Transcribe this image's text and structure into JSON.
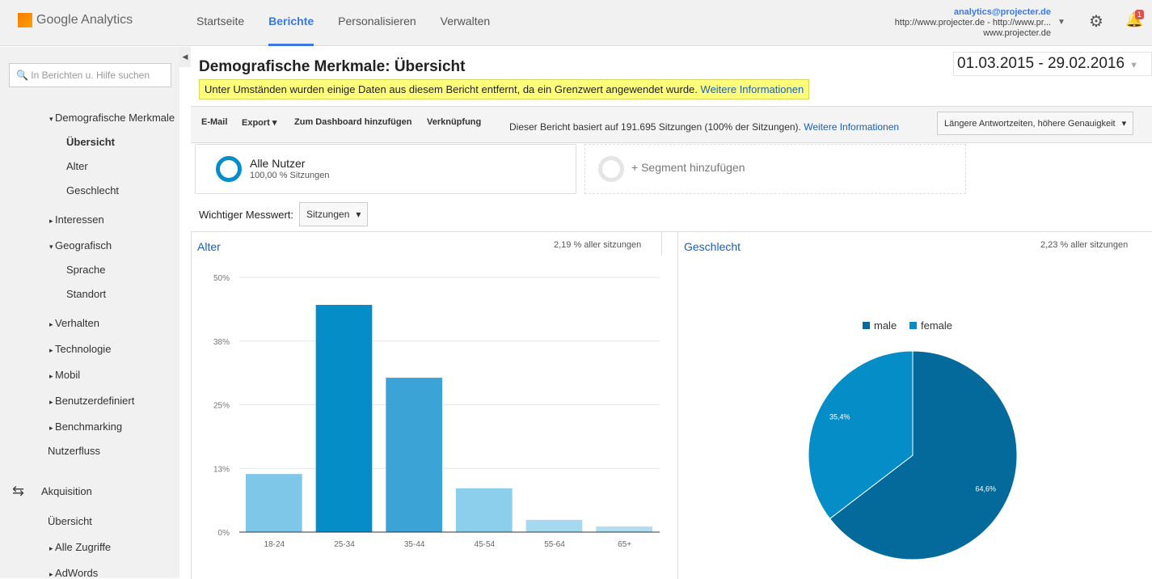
{
  "header": {
    "logo": "Google Analytics",
    "nav": [
      "Startseite",
      "Berichte",
      "Personalisieren",
      "Verwalten"
    ],
    "active_nav": "Berichte",
    "account_email": "analytics@projecter.de",
    "account_property": "http://www.projecter.de - http://www.pr...",
    "account_view": "www.projecter.de",
    "notification_count": "1"
  },
  "sidebar": {
    "search_placeholder": "In Berichten u. Hilfe suchen",
    "items": [
      {
        "label": "Demografische Merkmale",
        "level": 1,
        "expanded": true
      },
      {
        "label": "Übersicht",
        "level": 2,
        "active": true
      },
      {
        "label": "Alter",
        "level": 2
      },
      {
        "label": "Geschlecht",
        "level": 2
      },
      {
        "label": "Interessen",
        "level": 1
      },
      {
        "label": "Geografisch",
        "level": 1,
        "expanded": true
      },
      {
        "label": "Sprache",
        "level": 2
      },
      {
        "label": "Standort",
        "level": 2
      },
      {
        "label": "Verhalten",
        "level": 1
      },
      {
        "label": "Technologie",
        "level": 1
      },
      {
        "label": "Mobil",
        "level": 1
      },
      {
        "label": "Benutzerdefiniert",
        "level": 1
      },
      {
        "label": "Benchmarking",
        "level": 1
      },
      {
        "label": "Nutzerfluss",
        "level": 0
      },
      {
        "label": "Akquisition",
        "level": -1
      },
      {
        "label": "Übersicht",
        "level": 0
      },
      {
        "label": "Alle Zugriffe",
        "level": 1
      },
      {
        "label": "AdWords",
        "level": 1
      }
    ]
  },
  "main": {
    "title": "Demografische Merkmale: Übersicht",
    "warning": "Unter Umständen wurden einige Daten aus diesem Bericht entfernt, da ein Grenzwert angewendet wurde.",
    "warning_link": "Weitere Informationen",
    "date_range": "01.03.2015 - 29.02.2016",
    "toolbar": {
      "email": "E-Mail",
      "export": "Export",
      "dashboard": "Zum Dashboard hinzufügen",
      "shortcut": "Verknüpfung",
      "info": "Dieser Bericht basiert auf 191.695 Sitzungen (100% der Sitzungen).",
      "info_link": "Weitere Informationen",
      "precision": "Längere Antwortzeiten, höhere Genauigkeit"
    },
    "segment": {
      "name": "Alle Nutzer",
      "detail": "100,00 % Sitzungen",
      "add": "+ Segment hinzufügen"
    },
    "metric_label": "Wichtiger Messwert:",
    "metric_value": "Sitzungen"
  },
  "chart_data": [
    {
      "type": "bar",
      "title": "Alter",
      "note": "2,19 % aller sitzungen",
      "categories": [
        "18-24",
        "25-34",
        "35-44",
        "45-54",
        "55-64",
        "65+"
      ],
      "values": [
        11.4,
        44.6,
        30.3,
        8.6,
        2.4,
        1.1
      ],
      "yticks": [
        "0%",
        "13%",
        "25%",
        "38%",
        "50%"
      ],
      "ylim": [
        0,
        50
      ],
      "grid": true,
      "colors": [
        "#7fc7e8",
        "#058dc7",
        "#3ba3d6",
        "#8ccfed",
        "#a5d9f0",
        "#b0ddf2"
      ]
    },
    {
      "type": "pie",
      "title": "Geschlecht",
      "note": "2,23 % aller sitzungen",
      "legend": "top",
      "slices": [
        {
          "name": "male",
          "value": 64.6,
          "label": "64,6%",
          "color": "#036a9b"
        },
        {
          "name": "female",
          "value": 35.4,
          "label": "35,4%",
          "color": "#058dc7"
        }
      ]
    }
  ]
}
